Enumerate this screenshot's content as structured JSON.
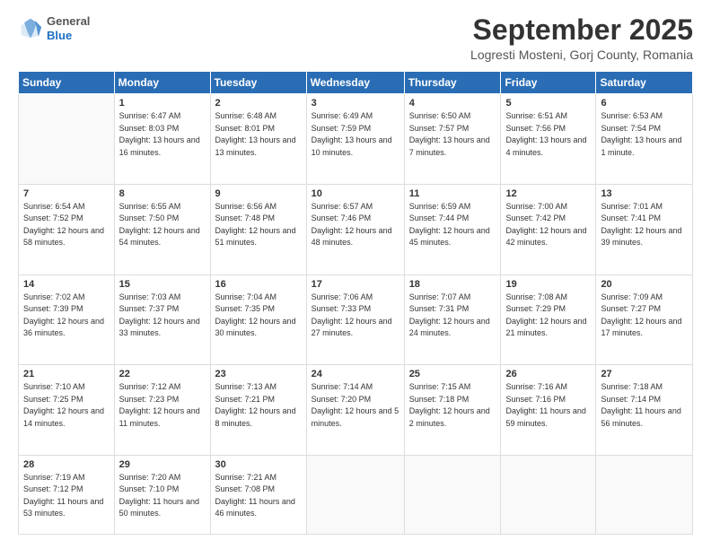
{
  "header": {
    "logo_general": "General",
    "logo_blue": "Blue",
    "month_title": "September 2025",
    "location": "Logresti Mosteni, Gorj County, Romania"
  },
  "weekdays": [
    "Sunday",
    "Monday",
    "Tuesday",
    "Wednesday",
    "Thursday",
    "Friday",
    "Saturday"
  ],
  "weeks": [
    [
      {
        "day": "",
        "sunrise": "",
        "sunset": "",
        "daylight": ""
      },
      {
        "day": "1",
        "sunrise": "Sunrise: 6:47 AM",
        "sunset": "Sunset: 8:03 PM",
        "daylight": "Daylight: 13 hours and 16 minutes."
      },
      {
        "day": "2",
        "sunrise": "Sunrise: 6:48 AM",
        "sunset": "Sunset: 8:01 PM",
        "daylight": "Daylight: 13 hours and 13 minutes."
      },
      {
        "day": "3",
        "sunrise": "Sunrise: 6:49 AM",
        "sunset": "Sunset: 7:59 PM",
        "daylight": "Daylight: 13 hours and 10 minutes."
      },
      {
        "day": "4",
        "sunrise": "Sunrise: 6:50 AM",
        "sunset": "Sunset: 7:57 PM",
        "daylight": "Daylight: 13 hours and 7 minutes."
      },
      {
        "day": "5",
        "sunrise": "Sunrise: 6:51 AM",
        "sunset": "Sunset: 7:56 PM",
        "daylight": "Daylight: 13 hours and 4 minutes."
      },
      {
        "day": "6",
        "sunrise": "Sunrise: 6:53 AM",
        "sunset": "Sunset: 7:54 PM",
        "daylight": "Daylight: 13 hours and 1 minute."
      }
    ],
    [
      {
        "day": "7",
        "sunrise": "Sunrise: 6:54 AM",
        "sunset": "Sunset: 7:52 PM",
        "daylight": "Daylight: 12 hours and 58 minutes."
      },
      {
        "day": "8",
        "sunrise": "Sunrise: 6:55 AM",
        "sunset": "Sunset: 7:50 PM",
        "daylight": "Daylight: 12 hours and 54 minutes."
      },
      {
        "day": "9",
        "sunrise": "Sunrise: 6:56 AM",
        "sunset": "Sunset: 7:48 PM",
        "daylight": "Daylight: 12 hours and 51 minutes."
      },
      {
        "day": "10",
        "sunrise": "Sunrise: 6:57 AM",
        "sunset": "Sunset: 7:46 PM",
        "daylight": "Daylight: 12 hours and 48 minutes."
      },
      {
        "day": "11",
        "sunrise": "Sunrise: 6:59 AM",
        "sunset": "Sunset: 7:44 PM",
        "daylight": "Daylight: 12 hours and 45 minutes."
      },
      {
        "day": "12",
        "sunrise": "Sunrise: 7:00 AM",
        "sunset": "Sunset: 7:42 PM",
        "daylight": "Daylight: 12 hours and 42 minutes."
      },
      {
        "day": "13",
        "sunrise": "Sunrise: 7:01 AM",
        "sunset": "Sunset: 7:41 PM",
        "daylight": "Daylight: 12 hours and 39 minutes."
      }
    ],
    [
      {
        "day": "14",
        "sunrise": "Sunrise: 7:02 AM",
        "sunset": "Sunset: 7:39 PM",
        "daylight": "Daylight: 12 hours and 36 minutes."
      },
      {
        "day": "15",
        "sunrise": "Sunrise: 7:03 AM",
        "sunset": "Sunset: 7:37 PM",
        "daylight": "Daylight: 12 hours and 33 minutes."
      },
      {
        "day": "16",
        "sunrise": "Sunrise: 7:04 AM",
        "sunset": "Sunset: 7:35 PM",
        "daylight": "Daylight: 12 hours and 30 minutes."
      },
      {
        "day": "17",
        "sunrise": "Sunrise: 7:06 AM",
        "sunset": "Sunset: 7:33 PM",
        "daylight": "Daylight: 12 hours and 27 minutes."
      },
      {
        "day": "18",
        "sunrise": "Sunrise: 7:07 AM",
        "sunset": "Sunset: 7:31 PM",
        "daylight": "Daylight: 12 hours and 24 minutes."
      },
      {
        "day": "19",
        "sunrise": "Sunrise: 7:08 AM",
        "sunset": "Sunset: 7:29 PM",
        "daylight": "Daylight: 12 hours and 21 minutes."
      },
      {
        "day": "20",
        "sunrise": "Sunrise: 7:09 AM",
        "sunset": "Sunset: 7:27 PM",
        "daylight": "Daylight: 12 hours and 17 minutes."
      }
    ],
    [
      {
        "day": "21",
        "sunrise": "Sunrise: 7:10 AM",
        "sunset": "Sunset: 7:25 PM",
        "daylight": "Daylight: 12 hours and 14 minutes."
      },
      {
        "day": "22",
        "sunrise": "Sunrise: 7:12 AM",
        "sunset": "Sunset: 7:23 PM",
        "daylight": "Daylight: 12 hours and 11 minutes."
      },
      {
        "day": "23",
        "sunrise": "Sunrise: 7:13 AM",
        "sunset": "Sunset: 7:21 PM",
        "daylight": "Daylight: 12 hours and 8 minutes."
      },
      {
        "day": "24",
        "sunrise": "Sunrise: 7:14 AM",
        "sunset": "Sunset: 7:20 PM",
        "daylight": "Daylight: 12 hours and 5 minutes."
      },
      {
        "day": "25",
        "sunrise": "Sunrise: 7:15 AM",
        "sunset": "Sunset: 7:18 PM",
        "daylight": "Daylight: 12 hours and 2 minutes."
      },
      {
        "day": "26",
        "sunrise": "Sunrise: 7:16 AM",
        "sunset": "Sunset: 7:16 PM",
        "daylight": "Daylight: 11 hours and 59 minutes."
      },
      {
        "day": "27",
        "sunrise": "Sunrise: 7:18 AM",
        "sunset": "Sunset: 7:14 PM",
        "daylight": "Daylight: 11 hours and 56 minutes."
      }
    ],
    [
      {
        "day": "28",
        "sunrise": "Sunrise: 7:19 AM",
        "sunset": "Sunset: 7:12 PM",
        "daylight": "Daylight: 11 hours and 53 minutes."
      },
      {
        "day": "29",
        "sunrise": "Sunrise: 7:20 AM",
        "sunset": "Sunset: 7:10 PM",
        "daylight": "Daylight: 11 hours and 50 minutes."
      },
      {
        "day": "30",
        "sunrise": "Sunrise: 7:21 AM",
        "sunset": "Sunset: 7:08 PM",
        "daylight": "Daylight: 11 hours and 46 minutes."
      },
      {
        "day": "",
        "sunrise": "",
        "sunset": "",
        "daylight": ""
      },
      {
        "day": "",
        "sunrise": "",
        "sunset": "",
        "daylight": ""
      },
      {
        "day": "",
        "sunrise": "",
        "sunset": "",
        "daylight": ""
      },
      {
        "day": "",
        "sunrise": "",
        "sunset": "",
        "daylight": ""
      }
    ]
  ]
}
